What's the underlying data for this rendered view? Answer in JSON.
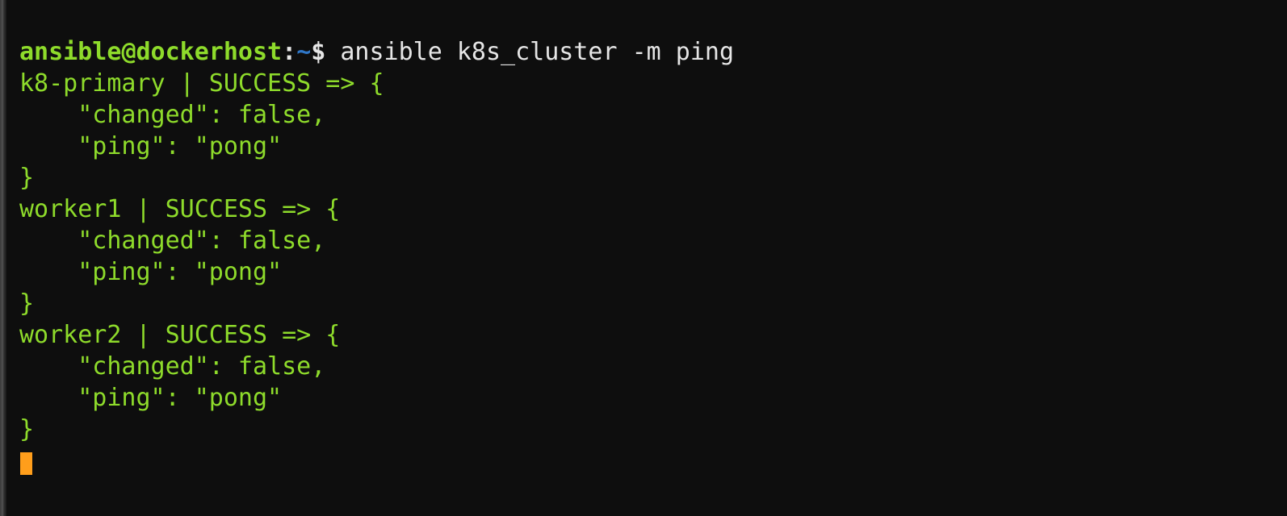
{
  "colors": {
    "background": "#0e0e0e",
    "prompt_green": "#8EDB2B",
    "prompt_white": "#e6e6e6",
    "prompt_blue": "#2f77c8",
    "output_green": "#8EDB2B",
    "cursor": "#ff9e1b"
  },
  "prompt": {
    "user": "ansible",
    "at": "@",
    "host": "dockerhost",
    "colon": ":",
    "cwd": "~",
    "symbol": "$",
    "command": "ansible k8s_cluster -m ping"
  },
  "results": [
    {
      "host": "k8-primary",
      "status": "SUCCESS",
      "lines": {
        "open": "k8-primary | SUCCESS => {",
        "changed": "    \"changed\": false,",
        "ping": "    \"ping\": \"pong\"",
        "close": "}"
      },
      "data": {
        "changed": false,
        "ping": "pong"
      }
    },
    {
      "host": "worker1",
      "status": "SUCCESS",
      "lines": {
        "open": "worker1 | SUCCESS => {",
        "changed": "    \"changed\": false,",
        "ping": "    \"ping\": \"pong\"",
        "close": "}"
      },
      "data": {
        "changed": false,
        "ping": "pong"
      }
    },
    {
      "host": "worker2",
      "status": "SUCCESS",
      "lines": {
        "open": "worker2 | SUCCESS => {",
        "changed": "    \"changed\": false,",
        "ping": "    \"ping\": \"pong\"",
        "close": "}"
      },
      "data": {
        "changed": false,
        "ping": "pong"
      }
    }
  ],
  "cursor": {
    "visible": true
  }
}
